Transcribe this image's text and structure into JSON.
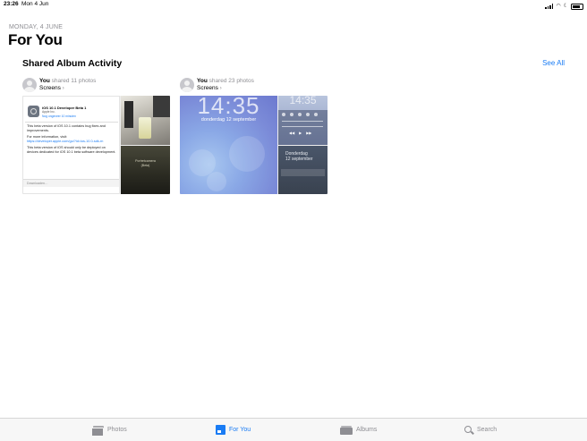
{
  "status_bar": {
    "time": "23:26",
    "date": "Mon 4 Jun"
  },
  "header": {
    "date": "MONDAY, 4 JUNE",
    "title": "For You"
  },
  "section": {
    "title": "Shared Album Activity",
    "see_all": "See All"
  },
  "cards": [
    {
      "user": "You",
      "action": "shared 11 photos",
      "album": "Screens",
      "tiles": {
        "update_title": "iOS 10.1 Developer Beta 1",
        "update_vendor": "Apple Inc.",
        "update_status": "Nog ongeveer 10 minuten",
        "para1": "This beta version of iOS 10.1 contains bug fixes and improvements.",
        "para2": "For more information, visit:",
        "link": "https://developer.apple.com/go/?id=ios-10.0-sdk-rn",
        "para3": "This beta version of iOS should only be deployed on devices dedicated for iOS 10.1 beta software development.",
        "downloading": "Downloaden…",
        "portrait_title": "Portretcamera",
        "portrait_sub": "(Beta)"
      }
    },
    {
      "user": "You",
      "action": "shared 23 photos",
      "album": "Screens",
      "tiles": {
        "clock": "14:35",
        "lock_date": "donderdag 12 september",
        "small_clock": "14:35",
        "day": "Donderdag",
        "day_date": "12 september"
      }
    }
  ],
  "tabs": [
    {
      "label": "Photos",
      "icon": "photos-icon",
      "active": false
    },
    {
      "label": "For You",
      "icon": "for-you-icon",
      "active": true
    },
    {
      "label": "Albums",
      "icon": "albums-icon",
      "active": false
    },
    {
      "label": "Search",
      "icon": "search-icon",
      "active": false
    }
  ],
  "colors": {
    "accent": "#1a7cf4",
    "inactive": "#8e8e93"
  }
}
